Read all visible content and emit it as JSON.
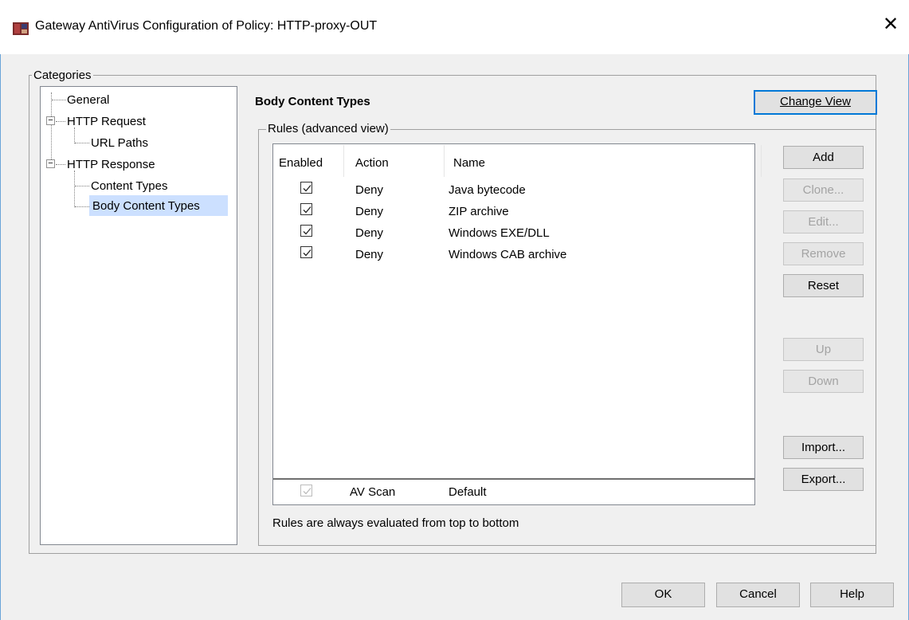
{
  "window": {
    "title": "Gateway AntiVirus Configuration of Policy: HTTP-proxy-OUT",
    "close_glyph": "✕"
  },
  "categories": {
    "legend": "Categories",
    "tree": [
      {
        "label": "General"
      },
      {
        "label": "HTTP Request",
        "expander": "⊟"
      },
      {
        "label": "URL Paths"
      },
      {
        "label": "HTTP Response",
        "expander": "⊟"
      },
      {
        "label": "Content Types"
      },
      {
        "label": "Body Content Types",
        "selected": true
      }
    ]
  },
  "main": {
    "heading": "Body Content Types",
    "change_view_label": "Change View",
    "rules_legend": "Rules (advanced view)",
    "columns": [
      "Enabled",
      "Action",
      "Name"
    ],
    "rows": [
      {
        "enabled": true,
        "action": "Deny",
        "name": "Java bytecode"
      },
      {
        "enabled": true,
        "action": "Deny",
        "name": "ZIP archive"
      },
      {
        "enabled": true,
        "action": "Deny",
        "name": "Windows EXE/DLL"
      },
      {
        "enabled": true,
        "action": "Deny",
        "name": "Windows CAB archive"
      }
    ],
    "default_row": {
      "enabled": true,
      "action": "AV Scan",
      "name": "Default"
    },
    "note": "Rules are always evaluated from top to bottom"
  },
  "side_buttons": {
    "add": "Add",
    "clone": "Clone...",
    "edit": "Edit...",
    "remove": "Remove",
    "reset": "Reset",
    "up": "Up",
    "down": "Down",
    "import": "Import...",
    "export": "Export..."
  },
  "footer": {
    "ok": "OK",
    "cancel": "Cancel",
    "help": "Help"
  },
  "colors": {
    "selection": "#cce0ff",
    "focus_border": "#0078d7",
    "window_border": "#6aa4d8"
  }
}
